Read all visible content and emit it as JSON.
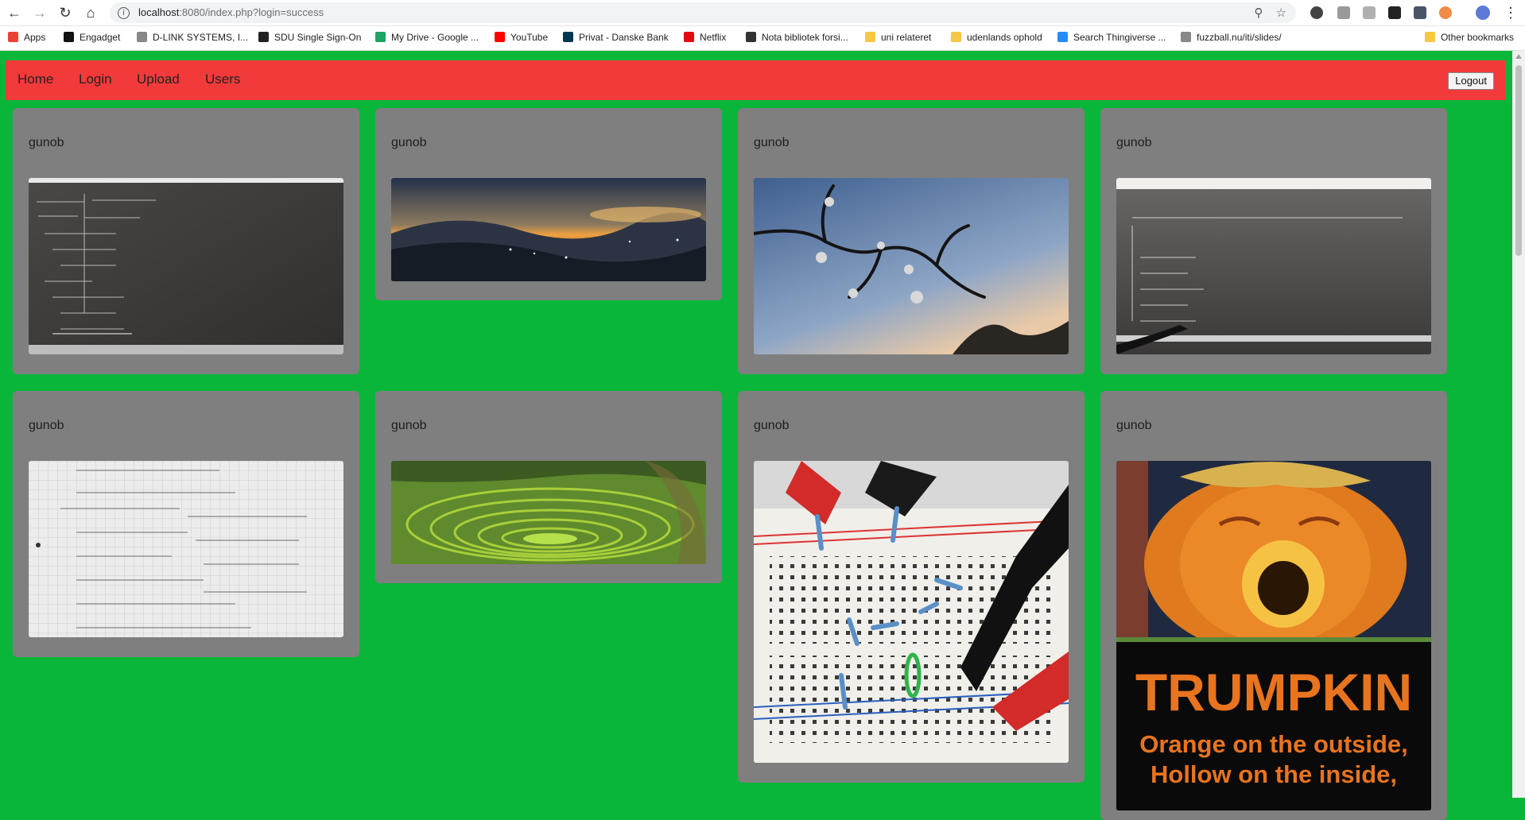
{
  "browser": {
    "url_host": "localhost",
    "url_rest": ":8080/index.php?login=success",
    "bookmarks": [
      {
        "label": "Apps",
        "icon": "apps-grid-icon",
        "color": "#e94235"
      },
      {
        "label": "Engadget",
        "icon": "engadget-icon",
        "color": "#111111"
      },
      {
        "label": "D-LINK SYSTEMS, I...",
        "icon": "page-icon",
        "color": "#888888"
      },
      {
        "label": "SDU Single Sign-On",
        "icon": "sso-icon",
        "color": "#222222"
      },
      {
        "label": "My Drive - Google ...",
        "icon": "google-drive-icon",
        "color": "#1ea362"
      },
      {
        "label": "YouTube",
        "icon": "youtube-icon",
        "color": "#ff0000"
      },
      {
        "label": "Privat - Danske Bank",
        "icon": "danske-bank-icon",
        "color": "#003755"
      },
      {
        "label": "Netflix",
        "icon": "netflix-icon",
        "color": "#e50914"
      },
      {
        "label": "Nota bibliotek forsi...",
        "icon": "nota-icon",
        "color": "#333333"
      },
      {
        "label": "uni relateret",
        "icon": "folder-icon",
        "color": "#f6c744"
      },
      {
        "label": "udenlands ophold",
        "icon": "folder-icon",
        "color": "#f6c744"
      },
      {
        "label": "Search Thingiverse ...",
        "icon": "thingiverse-icon",
        "color": "#248bfb"
      },
      {
        "label": "fuzzball.nu/iti/slides/",
        "icon": "page-icon",
        "color": "#888888"
      }
    ],
    "other_bookmarks": "Other bookmarks"
  },
  "nav": {
    "links": [
      "Home",
      "Login",
      "Upload",
      "Users"
    ],
    "logout": "Logout"
  },
  "posts": [
    {
      "author": "gunob",
      "image": "chalkboard-math"
    },
    {
      "author": "gunob",
      "image": "night-mountain-valley"
    },
    {
      "author": "gunob",
      "image": "cherry-blossom-branch"
    },
    {
      "author": "gunob",
      "image": "chalkboard-integrals"
    },
    {
      "author": "gunob",
      "image": "handwritten-math-notes"
    },
    {
      "author": "gunob",
      "image": "moray-terraces"
    },
    {
      "author": "gunob",
      "image": "breadboard-circuit"
    },
    {
      "author": "gunob",
      "image": "trumpkin-meme",
      "caption_title": "TRUMPKIN",
      "caption_line1": "Orange on the outside,",
      "caption_line2": "Hollow on the inside,"
    }
  ],
  "colors": {
    "page_bg": "#0ab63a",
    "nav_bg": "#f33a3a",
    "card_bg": "#7f7f7f"
  }
}
